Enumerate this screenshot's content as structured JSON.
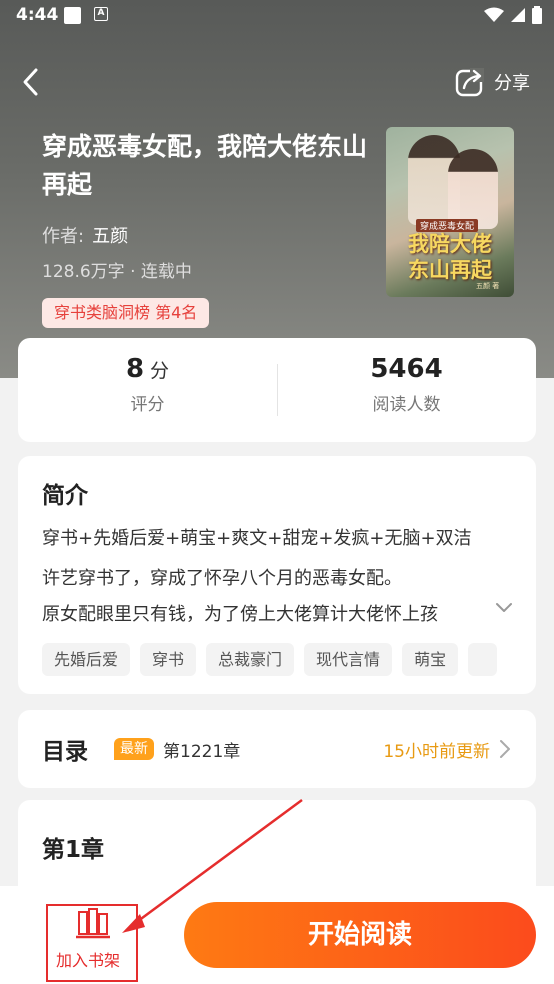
{
  "status": {
    "time": "4:44",
    "a_icon": "A"
  },
  "header": {
    "share_label": "分享"
  },
  "book": {
    "title": "穿成恶毒女配，我陪大佬东山再起",
    "author_label": "作者:",
    "author": "五颜",
    "meta": "128.6万字 · 连载中",
    "rank": "穿书类脑洞榜  第4名",
    "cover": {
      "subtitle": "穿成恶毒女配",
      "title_line1": "我陪大佬",
      "title_line2": "东山再起",
      "author_mark": "五颜 著"
    }
  },
  "stats": {
    "score": "8",
    "score_unit": "分",
    "score_label": "评分",
    "readers": "5464",
    "readers_label": "阅读人数"
  },
  "intro": {
    "heading": "简介",
    "lines": [
      "穿书+先婚后爱+萌宝+爽文+甜宠+发疯+无脑+双洁",
      "许艺穿书了，穿成了怀孕八个月的恶毒女配。",
      "原女配眼里只有钱，为了傍上大佬算计大佬怀上孩"
    ],
    "tags": [
      "先婚后爱",
      "穿书",
      "总裁豪门",
      "现代言情",
      "萌宝"
    ]
  },
  "toc": {
    "heading": "目录",
    "new_badge": "最新",
    "latest_chapter": "第1221章",
    "update_time": "15小时前更新"
  },
  "chapter_preview": {
    "heading": "第1章"
  },
  "bottom": {
    "shelf_label": "加入书架",
    "start_label": "开始阅读"
  },
  "colors": {
    "accent": "#fc5a1a",
    "rank_text": "#e6413c",
    "annotation": "#e52d2d"
  }
}
